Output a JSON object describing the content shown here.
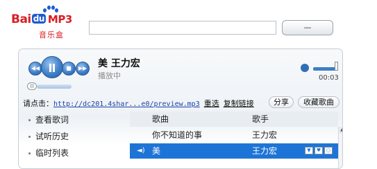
{
  "header": {
    "logo_bai": "Bai",
    "logo_du": "du",
    "logo_mp3": "MP3",
    "logo_sub": "音乐盒",
    "search_value": "",
    "search_button": "—"
  },
  "player": {
    "song_title": "美  王力宏",
    "status": "播放中",
    "time": "00:03",
    "progress_fraction": 0.03,
    "volume_fraction": 0.95
  },
  "link_bar": {
    "prompt": "请点击：",
    "url": "http://dc201.4shar...e0/preview.mp3",
    "reselect": "重选",
    "copy_link": "复制链接",
    "share": "分享",
    "collect": "收藏歌曲"
  },
  "side_menu": {
    "items": [
      {
        "label": "查看歌词"
      },
      {
        "label": "试听历史"
      },
      {
        "label": "临时列表"
      }
    ]
  },
  "song_list": {
    "headers": {
      "song": "歌曲",
      "artist": "歌手"
    },
    "rows": [
      {
        "song": "你不知道的事",
        "artist": "王力宏",
        "playing": false
      },
      {
        "song": "美",
        "artist": "王力宏",
        "playing": true
      }
    ]
  },
  "icons": {
    "prev": "previous-icon",
    "play_pause": "pause-icon",
    "stop": "stop-icon",
    "next": "next-icon",
    "volume": "speaker-icon",
    "playing_indicator": "playing-speaker-icon"
  },
  "colors": {
    "accent_blue": "#1e74d6",
    "logo_red": "#d81e25",
    "logo_blue": "#1c5bd2"
  }
}
